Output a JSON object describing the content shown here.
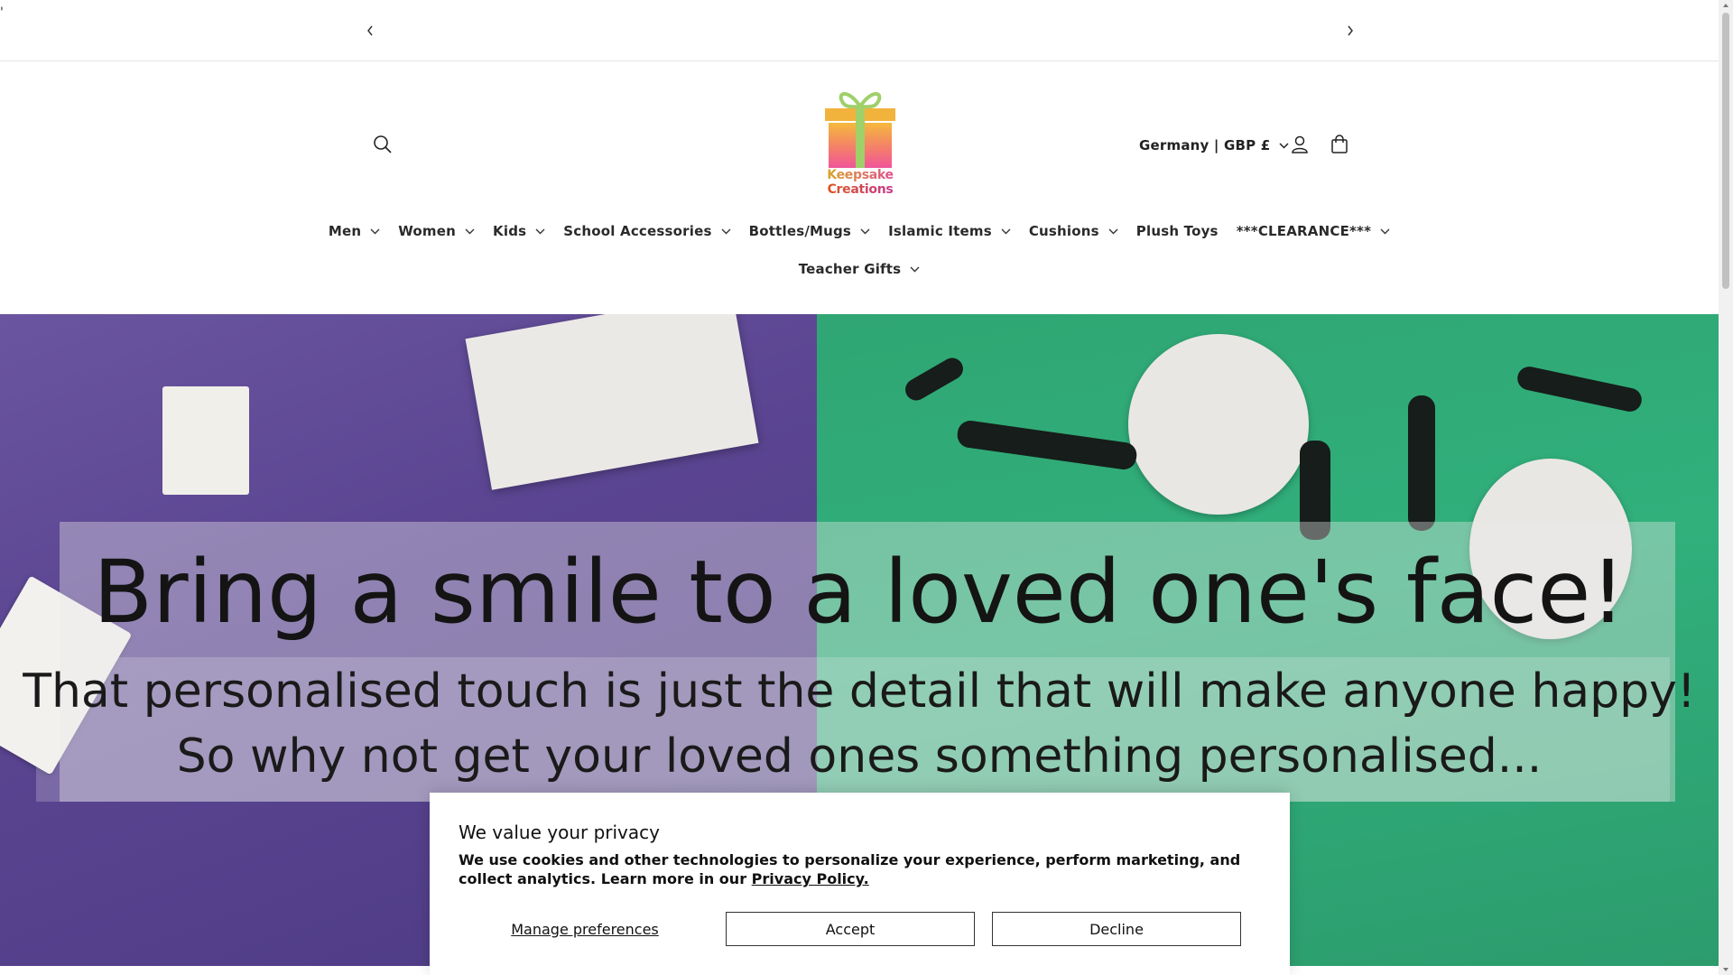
{
  "page": {
    "stray_mark": "'"
  },
  "announcement": {
    "prev_icon": "chevron-left-icon",
    "next_icon": "chevron-right-icon"
  },
  "header": {
    "logo": {
      "line1": "Keepsake",
      "line2": "Creations",
      "colors": [
        "#f2b33d",
        "#f5658f",
        "#9fd06a"
      ]
    },
    "locale_label": "Germany | GBP £",
    "icons": [
      "search-icon",
      "account-icon",
      "cart-icon",
      "chevron-down-icon"
    ]
  },
  "nav": {
    "row1": [
      {
        "label": "Men",
        "dropdown": true
      },
      {
        "label": "Women",
        "dropdown": true
      },
      {
        "label": "Kids",
        "dropdown": true
      },
      {
        "label": "School Accessories",
        "dropdown": true
      },
      {
        "label": "Bottles/Mugs",
        "dropdown": true
      },
      {
        "label": "Islamic Items",
        "dropdown": true
      },
      {
        "label": "Cushions",
        "dropdown": true
      },
      {
        "label": "Plush Toys",
        "dropdown": false
      },
      {
        "label": "***CLEARANCE***",
        "dropdown": true
      }
    ],
    "row2": [
      {
        "label": "Teacher Gifts",
        "dropdown": true
      }
    ]
  },
  "hero": {
    "heading": "Bring a smile to a loved one's face!",
    "line1": "That personalised touch is just the detail that will make anyone happy!",
    "line2": "So why not get your loved ones something personalised...",
    "colors": {
      "left": "#5b4592",
      "right": "#31b07c"
    }
  },
  "cookie": {
    "title": "We value your privacy",
    "body": "We use cookies and other technologies to personalize your experience, perform marketing, and collect analytics. Learn more in our",
    "link": "Privacy Policy.",
    "manage_label": "Manage preferences",
    "accept_label": "Accept",
    "decline_label": "Decline"
  }
}
